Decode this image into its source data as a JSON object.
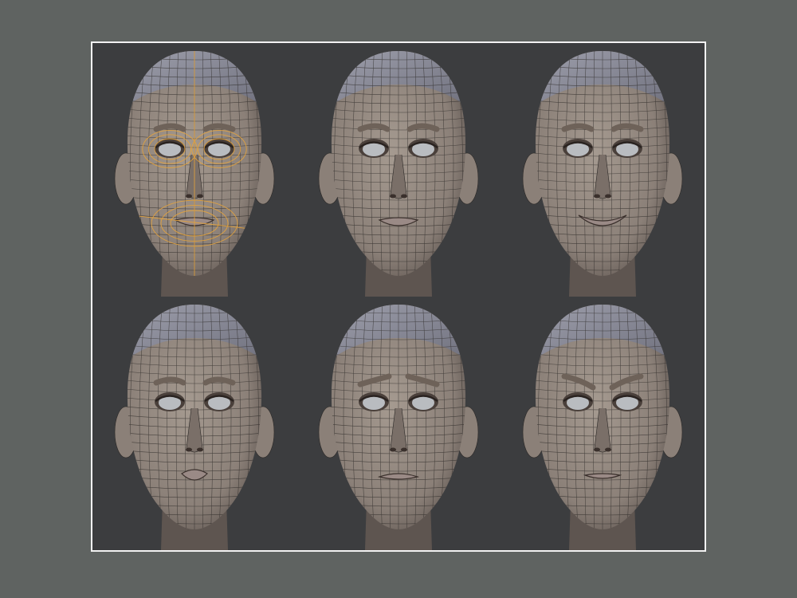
{
  "image": {
    "kind": "3d-head-wireframe-expression-sheet",
    "colors": {
      "page_background": "#5f6361",
      "frame_border": "#f2f2f2",
      "viewport_background": "#3c3d3f",
      "skin": "#8b8078",
      "skin_shadow": "#5e5550",
      "scalp": "#8e8f9c",
      "wire": "#2b2826",
      "eye": "#b9bcc0",
      "highlight_edges": "#e8a53a"
    },
    "panels": [
      {
        "id": "neutral-topology",
        "expression": "neutral",
        "highlight": true
      },
      {
        "id": "neutral",
        "expression": "neutral",
        "highlight": false
      },
      {
        "id": "smile",
        "expression": "smile",
        "highlight": false
      },
      {
        "id": "pout",
        "expression": "pout",
        "highlight": false
      },
      {
        "id": "sad",
        "expression": "sad",
        "highlight": false
      },
      {
        "id": "angry",
        "expression": "angry",
        "highlight": false
      }
    ]
  }
}
